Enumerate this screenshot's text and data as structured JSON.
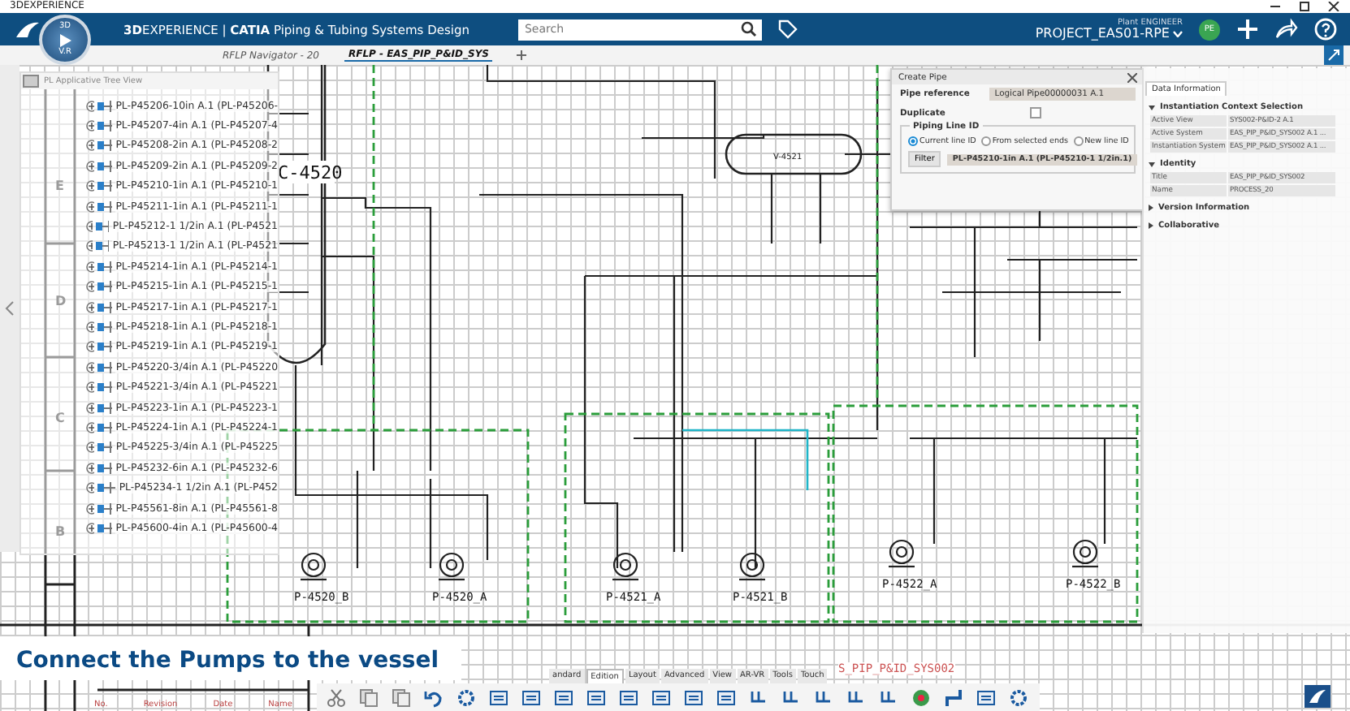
{
  "window": {
    "title": "3DEXPERIENCE"
  },
  "header": {
    "compass_top": "3D",
    "compass_bottom": "V.R",
    "app_title": "**3D**EXPERIENCE | **CATIA** Piping & Tubing Systems Design",
    "search": {
      "placeholder": "Search"
    },
    "role": "Plant ENGINEER",
    "project": "PROJECT_EAS01-RPE",
    "avatar": "PE"
  },
  "tabs": [
    {
      "label": "RFLP Navigator - 20",
      "selected": false
    },
    {
      "label": "RFLP - EAS_PIP_P&ID_SYS",
      "selected": true
    }
  ],
  "tree": {
    "title": "PL Applicative Tree View",
    "items": [
      "PL-P45206-10in A.1 (PL-P45206-",
      "PL-P45207-4in A.1 (PL-P45207-4",
      "PL-P45208-2in A.1 (PL-P45208-2",
      "PL-P45209-2in A.1 (PL-P45209-2",
      "PL-P45210-1in A.1 (PL-P45210-1",
      "PL-P45211-1in A.1 (PL-P45211-1",
      "PL-P45212-1 1/2in A.1 (PL-P4521",
      "PL-P45213-1 1/2in A.1 (PL-P4521",
      "PL-P45214-1in A.1 (PL-P45214-1",
      "PL-P45215-1in A.1 (PL-P45215-1",
      "PL-P45217-1in A.1 (PL-P45217-1",
      "PL-P45218-1in A.1 (PL-P45218-1",
      "PL-P45219-1in A.1 (PL-P45219-1",
      "PL-P45220-3/4in A.1 (PL-P45220",
      "PL-P45221-3/4in A.1 (PL-P45221",
      "PL-P45223-1in A.1 (PL-P45223-1",
      "PL-P45224-1in A.1 (PL-P45224-1",
      "PL-P45225-3/4in A.1 (PL-P45225",
      "PL-P45232-6in A.1 (PL-P45232-6",
      "PL-P45234-1 1/2in A.1 (PL-P452",
      "PL-P45561-8in A.1 (PL-P45561-8",
      "PL-P45600-4in A.1 (PL-P45600-4"
    ]
  },
  "drawing": {
    "zones": [
      "E",
      "D",
      "C",
      "B"
    ],
    "column": "C-4520",
    "vessel": "V-4521",
    "pumps": [
      {
        "label": "P-4520_B"
      },
      {
        "label": "P-4520_A"
      },
      {
        "label": "P-4521_A"
      },
      {
        "label": "P-4521_B"
      },
      {
        "label": "P-4522_A"
      },
      {
        "label": "P-4522_B"
      }
    ],
    "sheet_name": "S_PIP_P&ID_SYS002",
    "title_block": [
      "No.",
      "Revision",
      "Date",
      "Name"
    ]
  },
  "dialog": {
    "title": "Create Pipe",
    "pipe_reference_label": "Pipe reference",
    "pipe_reference": "Logical Pipe00000031 A.1",
    "duplicate_label": "Duplicate",
    "duplicate": false,
    "group_title": "Piping Line ID",
    "options": [
      {
        "label": "Current line ID",
        "selected": true
      },
      {
        "label": "From selected ends",
        "selected": false
      },
      {
        "label": "New line ID",
        "selected": false
      }
    ],
    "filter_button": "Filter",
    "line_id": "PL-P45210-1in A.1 (PL-P45210-1 1/2in.1)"
  },
  "data_panel": {
    "tab": "Data Information",
    "sections": [
      {
        "title": "Instantiation Context Selection",
        "expanded": true,
        "rows": [
          {
            "label": "Active View",
            "value": "SYS002-P&ID-2 A.1"
          },
          {
            "label": "Active System",
            "value": "EAS_PIP_P&ID_SYS002 A.1 ..."
          },
          {
            "label": "Instantiation System",
            "value": "EAS_PIP_P&ID_SYS002 A.1 ..."
          }
        ]
      },
      {
        "title": "Identity",
        "expanded": true,
        "rows": [
          {
            "label": "Title",
            "value": "EAS_PIP_P&ID_SYS002"
          },
          {
            "label": "Name",
            "value": "PROCESS_20"
          }
        ]
      },
      {
        "title": "Version Information",
        "expanded": false
      },
      {
        "title": "Collaborative",
        "expanded": false
      }
    ]
  },
  "caption": "Connect the Pumps to the vessel",
  "toolbar": {
    "tabs": [
      {
        "label": "andard",
        "selected": false
      },
      {
        "label": "Edition",
        "selected": true
      },
      {
        "label": "Layout",
        "selected": false
      },
      {
        "label": "Advanced",
        "selected": false
      },
      {
        "label": "View",
        "selected": false
      },
      {
        "label": "AR-VR",
        "selected": false
      },
      {
        "label": "Tools",
        "selected": false
      },
      {
        "label": "Touch",
        "selected": false
      }
    ]
  }
}
